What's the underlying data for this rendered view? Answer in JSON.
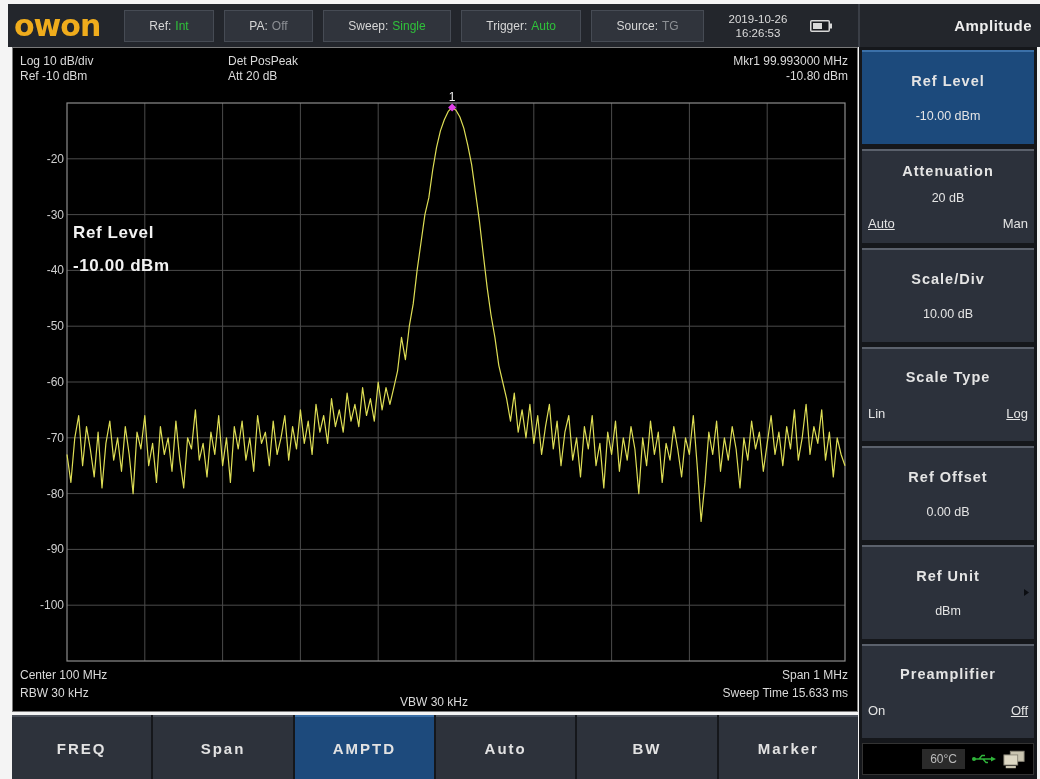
{
  "top_bar": {
    "logo": "owon",
    "status": [
      {
        "label": "Ref:",
        "value": "Int",
        "color": "#2fc23a"
      },
      {
        "label": "PA:",
        "value": "Off",
        "color": "#8c8f94"
      },
      {
        "label": "Sweep:",
        "value": "Single",
        "color": "#2fc23a"
      },
      {
        "label": "Trigger:",
        "value": "Auto",
        "color": "#2fc23a"
      },
      {
        "label": "Source:",
        "value": "TG",
        "color": "#8c8f94"
      }
    ],
    "date": "2019-10-26",
    "time": "16:26:53"
  },
  "screen": {
    "header": {
      "left": [
        "Log 10 dB/div",
        "Ref -10 dBm"
      ],
      "middle": [
        "Det PosPeak",
        "Att 20 dB"
      ],
      "right": [
        "Mkr1 99.993000 MHz",
        "-10.80 dBm"
      ]
    },
    "overlay": {
      "label": "Ref Level",
      "value": "-10.00 dBm"
    },
    "chart_data": [
      {
        "type": "line",
        "ylim": [
          -110,
          -10
        ],
        "yticks": [
          -20,
          -30,
          -40,
          -50,
          -60,
          -70,
          -80,
          -90,
          -100
        ],
        "tick_labels": "y",
        "grid": true,
        "color": "#dede55",
        "annotations": [
          "1"
        ],
        "categories": [
          null,
          null,
          null,
          null,
          null,
          null,
          null,
          null,
          null,
          null,
          null,
          null,
          null,
          null,
          null,
          null,
          null,
          null,
          null,
          null,
          null,
          null,
          null,
          null,
          null,
          null,
          null,
          null,
          null,
          null,
          null,
          null,
          null,
          null,
          null,
          null,
          null,
          null,
          null,
          null,
          null,
          null,
          null,
          null,
          null,
          null,
          null,
          null,
          null,
          null,
          null,
          null,
          null,
          null,
          null,
          null,
          null,
          null,
          null,
          null,
          null,
          null,
          null,
          null,
          null,
          null,
          null,
          null,
          null,
          null,
          null,
          null,
          null,
          null,
          null,
          null,
          null,
          null,
          null,
          null,
          null,
          null,
          null,
          null,
          null,
          null,
          null,
          null,
          null,
          null,
          null,
          null,
          null,
          null,
          null,
          null,
          null,
          null,
          null,
          null,
          null,
          null,
          null,
          null,
          null,
          null,
          null,
          null,
          null,
          null,
          null,
          null,
          null,
          null,
          null,
          null,
          null,
          null,
          null,
          null,
          null,
          null,
          null,
          null,
          null,
          null,
          null,
          null,
          null,
          null,
          null,
          null,
          null,
          null,
          null,
          null,
          null,
          null,
          null,
          null,
          null,
          null,
          null,
          null,
          null,
          null,
          null,
          null,
          null,
          null,
          null,
          null,
          null,
          null,
          null,
          null,
          null,
          null,
          null,
          null,
          null,
          null,
          null,
          null,
          null,
          null,
          null,
          null,
          null,
          null,
          null,
          null,
          null,
          null,
          null,
          null,
          null,
          null,
          null,
          null,
          null,
          null,
          null,
          null,
          null,
          null,
          null,
          null,
          null,
          null,
          null,
          null,
          null,
          null,
          null,
          null,
          null,
          null,
          null,
          null,
          null
        ],
        "values": [
          -73,
          -78,
          -70,
          -66,
          -75,
          -68,
          -72,
          -77,
          -69,
          -79,
          -71,
          -67,
          -74,
          -70,
          -76,
          -68,
          -73,
          -80,
          -69,
          -72,
          -66,
          -75,
          -71,
          -78,
          -68,
          -73,
          -70,
          -76,
          -67,
          -74,
          -79,
          -70,
          -72,
          -65,
          -74,
          -71,
          -77,
          -69,
          -73,
          -66,
          -75,
          -70,
          -78,
          -68,
          -72,
          -67,
          -74,
          -70,
          -76,
          -66,
          -71,
          -69,
          -75,
          -67,
          -73,
          -70,
          -66,
          -74,
          -68,
          -72,
          -65,
          -71,
          -67,
          -73,
          -64,
          -69,
          -66,
          -71,
          -63,
          -68,
          -65,
          -69,
          -62,
          -67,
          -64,
          -68,
          -61,
          -66,
          -63,
          -67,
          -60,
          -65,
          -61,
          -64,
          -61,
          -58,
          -52,
          -56,
          -50,
          -46,
          -40,
          -35,
          -30,
          -27,
          -22,
          -18,
          -15,
          -13,
          -11.5,
          -10.8,
          -11.3,
          -12.5,
          -14.5,
          -17.5,
          -21,
          -26,
          -31,
          -37,
          -43,
          -48,
          -52,
          -57,
          -60,
          -63,
          -67,
          -62,
          -69,
          -65,
          -70,
          -64,
          -71,
          -66,
          -73,
          -68,
          -64,
          -72,
          -67,
          -75,
          -69,
          -66,
          -74,
          -70,
          -77,
          -68,
          -72,
          -66,
          -75,
          -71,
          -79,
          -69,
          -73,
          -67,
          -76,
          -70,
          -74,
          -68,
          -72,
          -80,
          -70,
          -75,
          -67,
          -73,
          -69,
          -78,
          -71,
          -74,
          -68,
          -72,
          -77,
          -70,
          -73,
          -66,
          -75,
          -85,
          -78,
          -69,
          -73,
          -67,
          -76,
          -70,
          -74,
          -68,
          -72,
          -79,
          -70,
          -74,
          -67,
          -72,
          -69,
          -76,
          -71,
          -66,
          -73,
          -69,
          -75,
          -68,
          -72,
          -65,
          -74,
          -70,
          -64,
          -73,
          -68,
          -71,
          -65,
          -74,
          -69,
          -77,
          -70,
          -73,
          -75
        ]
      }
    ],
    "footer": {
      "left": [
        "Center 100 MHz",
        "RBW 30 kHz"
      ],
      "middle": [
        "VBW 30 kHz"
      ],
      "right": [
        "Span 1 MHz",
        "Sweep Time 15.633 ms"
      ]
    }
  },
  "tabs": [
    {
      "label": "FREQ",
      "selected": false
    },
    {
      "label": "Span",
      "selected": false
    },
    {
      "label": "AMPTD",
      "selected": true
    },
    {
      "label": "Auto",
      "selected": false
    },
    {
      "label": "BW",
      "selected": false
    },
    {
      "label": "Marker",
      "selected": false
    }
  ],
  "side_panel": {
    "title": "Amplitude",
    "softkeys": [
      {
        "label": "Ref Level",
        "value": "-10.00 dBm",
        "selected": true,
        "submenu": false
      },
      {
        "label": "Attenuation",
        "value": "20 dB",
        "options": [
          {
            "label": "Auto",
            "selected": true
          },
          {
            "label": "Man",
            "selected": false
          }
        ],
        "selected": false,
        "submenu": false
      },
      {
        "label": "Scale/Div",
        "value": "10.00 dB",
        "selected": false,
        "submenu": false
      },
      {
        "label": "Scale Type",
        "options": [
          {
            "label": "Lin",
            "selected": false
          },
          {
            "label": "Log",
            "selected": true
          }
        ],
        "selected": false,
        "submenu": false
      },
      {
        "label": "Ref Offset",
        "value": "0.00 dB",
        "selected": false,
        "submenu": false
      },
      {
        "label": "Ref Unit",
        "value": "dBm",
        "selected": false,
        "submenu": true
      },
      {
        "label": "Preamplifier",
        "options": [
          {
            "label": "On",
            "selected": false
          },
          {
            "label": "Off",
            "selected": true
          }
        ],
        "selected": false,
        "submenu": false
      }
    ],
    "status": {
      "temperature": "60°C"
    }
  }
}
